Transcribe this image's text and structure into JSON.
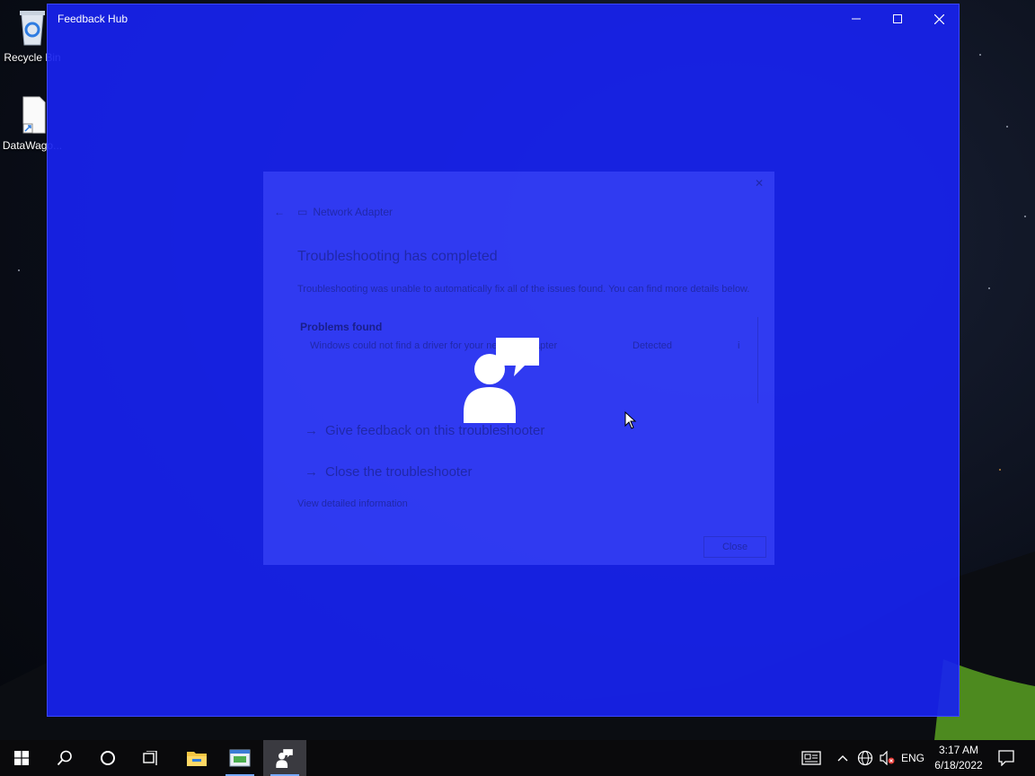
{
  "desktop": {
    "icons": [
      {
        "label": "Recycle Bin",
        "icon": "recycle-bin-icon"
      },
      {
        "label": "DataWago...",
        "icon": "shortcut-file-icon"
      }
    ]
  },
  "window": {
    "title": "Feedback Hub",
    "controls": {
      "minimize": "minimize-icon",
      "maximize": "maximize-icon",
      "close": "close-icon"
    },
    "background": "#1822ee"
  },
  "ghost_dialog": {
    "app_title": "Network Adapter",
    "heading": "Troubleshooting has completed",
    "description": "Troubleshooting was unable to automatically fix all of the issues found. You can find more details below.",
    "problems_header": "Problems found",
    "issue": "Windows could not find a driver for your network adapter",
    "issue_status": "Detected",
    "links": [
      "Give feedback on this troubleshooter",
      "Close the troubleshooter"
    ],
    "detail_link": "View detailed information",
    "close_button": "Close"
  },
  "splash": {
    "icon": "feedback-hub-logo-icon"
  },
  "taskbar": {
    "buttons": [
      {
        "name": "start-button",
        "icon": "windows-logo-icon"
      },
      {
        "name": "search-button",
        "icon": "search-icon"
      },
      {
        "name": "cortana-button",
        "icon": "cortana-circle-icon"
      },
      {
        "name": "task-view-button",
        "icon": "task-view-icon"
      },
      {
        "name": "file-explorer-button",
        "icon": "folder-icon"
      },
      {
        "name": "app-button",
        "icon": "app-window-icon"
      },
      {
        "name": "feedback-hub-button",
        "icon": "feedback-hub-icon"
      }
    ],
    "tray": {
      "language": "ENG",
      "time": "3:17 AM",
      "date": "6/18/2022"
    }
  }
}
